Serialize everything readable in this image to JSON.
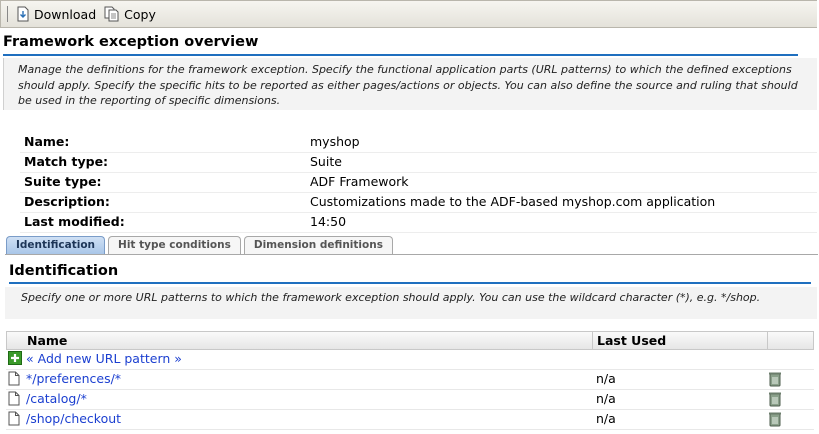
{
  "toolbar": {
    "download_label": "Download",
    "copy_label": "Copy"
  },
  "page": {
    "title": "Framework exception overview",
    "description": "Manage the definitions for the framework exception. Specify the functional application parts (URL patterns) to which the defined exceptions should apply. Specify the specific hits to be reported as either pages/actions or objects. You can also define the source and ruling that should be used in the reporting of specific dimensions."
  },
  "properties": [
    {
      "label": "Name:",
      "value": "myshop"
    },
    {
      "label": "Match type:",
      "value": "Suite"
    },
    {
      "label": "Suite type:",
      "value": "ADF Framework"
    },
    {
      "label": "Description:",
      "value": "Customizations made to the ADF-based myshop.com application"
    },
    {
      "label": "Last modified:",
      "value": "14:50"
    }
  ],
  "tabs": [
    {
      "label": "Identification",
      "active": true
    },
    {
      "label": "Hit type conditions",
      "active": false
    },
    {
      "label": "Dimension definitions",
      "active": false
    }
  ],
  "section": {
    "title": "Identification",
    "description": "Specify one or more URL patterns to which the framework exception should apply. You can use the wildcard character (*), e.g. */shop."
  },
  "grid": {
    "columns": {
      "name": "Name",
      "last_used": "Last Used"
    },
    "add_label": "« Add new URL pattern »",
    "rows": [
      {
        "name": "*/preferences/*",
        "last_used": "n/a"
      },
      {
        "name": "/catalog/*",
        "last_used": "n/a"
      },
      {
        "name": "/shop/checkout",
        "last_used": "n/a"
      }
    ]
  },
  "colors": {
    "accent_line": "#1f6fbf",
    "link": "#1b3fd0",
    "active_tab": "#a9c6e8"
  },
  "icons": {
    "download": "download-icon",
    "copy": "copy-icon",
    "add": "add-icon",
    "row": "document-icon",
    "delete": "trash-icon"
  }
}
